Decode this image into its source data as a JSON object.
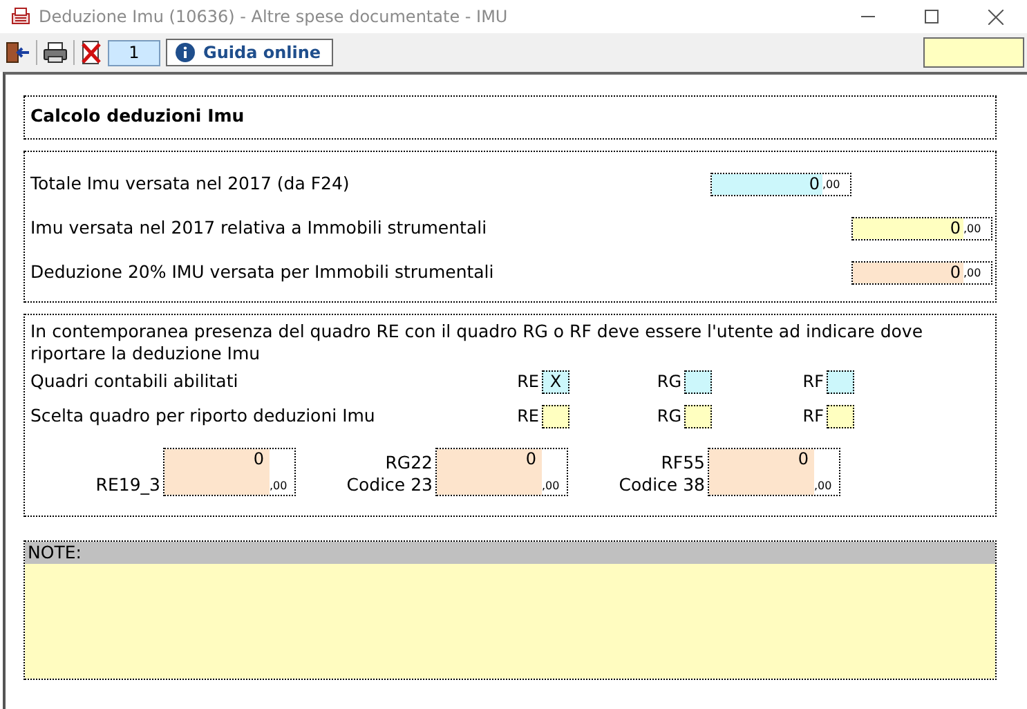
{
  "window": {
    "title": "Deduzione Imu (10636) - Altre spese documentate - IMU"
  },
  "toolbar": {
    "page": "1",
    "help_button": "Guida online",
    "search_field": {
      "color": "#ffffc0"
    }
  },
  "section_title": "Calcolo deduzioni Imu",
  "amounts": [
    {
      "kind": "total",
      "label": "Totale Imu versata nel 2017 (da F24)",
      "value": "0",
      "decimals": ",00",
      "color": "#ccf7fb"
    },
    {
      "kind": "detail",
      "label": "Imu versata nel 2017 relativa a Immobili strumentali",
      "value": "0",
      "decimals": ",00",
      "color": "#ffffc0"
    },
    {
      "kind": "detail",
      "label": "Deduzione 20% IMU versata per Immobili strumentali",
      "value": "0",
      "decimals": ",00",
      "color": "#fde4cc"
    }
  ],
  "choice": {
    "note": "In contemporanea presenza del quadro RE con il quadro RG o RF deve essere l'utente ad indicare dove riportare la deduzione Imu",
    "rows": [
      {
        "label": "Quadri contabili abilitati",
        "boxes": [
          {
            "code": "RE",
            "value": "X",
            "color": "#ccf7fb"
          },
          {
            "code": "RG",
            "color": "#ccf7fb"
          },
          {
            "code": "RF",
            "color": "#ccf7fb"
          }
        ]
      },
      {
        "label": "Scelta quadro per riporto deduzioni Imu",
        "boxes": [
          {
            "code": "RE",
            "color": "#ffffc0"
          },
          {
            "code": "RG",
            "color": "#ffffc0"
          },
          {
            "code": "RF",
            "color": "#ffffc0"
          }
        ]
      }
    ],
    "deductions": [
      {
        "label_lines": [
          "RE19_3"
        ],
        "value": "0",
        "decimals": ",00",
        "color": "#fde4cc"
      },
      {
        "label_lines": [
          "RG22",
          "Codice 23"
        ],
        "value": "0",
        "decimals": ",00",
        "color": "#fde4cc"
      },
      {
        "label_lines": [
          "RF55",
          "Codice 38"
        ],
        "value": "0",
        "decimals": ",00",
        "color": "#fde4cc"
      }
    ]
  },
  "notes": {
    "label": "NOTE:",
    "color": "#fffcc0"
  }
}
